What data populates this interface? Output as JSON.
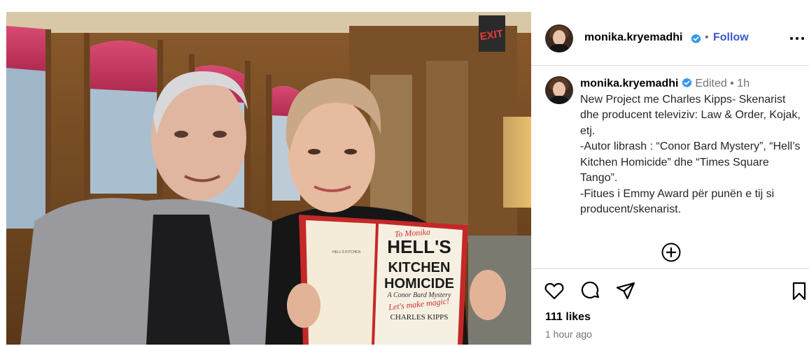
{
  "post": {
    "author": "monika.kryemadhi",
    "follow_label": "Follow",
    "dot": "•",
    "book": {
      "title_lines": [
        "HELL'S",
        "KITCHEN",
        "HOMICIDE"
      ],
      "subtitle": "A Conor Bard Mystery",
      "author": "CHARLES KIPPS",
      "inscription_top": "To Monika",
      "inscription_bottom": "Let's make magic!"
    },
    "exit_sign": "EXIT"
  },
  "caption": {
    "username": "monika.kryemadhi",
    "edited": "Edited",
    "bullet": "•",
    "age": "1h",
    "lines": [
      "New Project me Charles Kipps- Skenarist dhe producent televiziv: Law & Order, Kojak, etj.",
      "-Autor librash : “Conor Bard Mystery”, “Hell’s Kitchen Homicide” dhe “Times Square Tango”.",
      "-Fitues i Emmy Award për punën e tij si producent/skenarist."
    ]
  },
  "engagement": {
    "likes": "111 likes",
    "posted": "1 hour ago"
  },
  "icons": {
    "like": "heart-icon",
    "comment": "comment-icon",
    "share": "send-icon",
    "save": "bookmark-icon",
    "add_comment": "plus-circle-icon",
    "more": "more-options-icon",
    "verified": "verified-badge-icon"
  },
  "colors": {
    "follow": "#3b59c8",
    "verified": "#3897f0",
    "muted": "#737373",
    "divider": "#dbdbdb"
  }
}
